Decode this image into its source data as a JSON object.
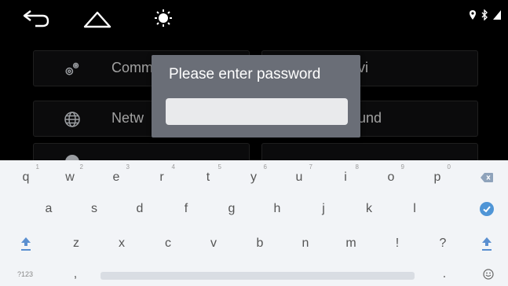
{
  "settings": {
    "tiles": [
      {
        "label": "Comm"
      },
      {
        "label": "vi"
      },
      {
        "label": "Netw"
      },
      {
        "label": "und"
      }
    ]
  },
  "dialog": {
    "title": "Please enter password",
    "input_value": ""
  },
  "keyboard": {
    "row1": [
      {
        "key": "q",
        "hint": "1"
      },
      {
        "key": "w",
        "hint": "2"
      },
      {
        "key": "e",
        "hint": "3"
      },
      {
        "key": "r",
        "hint": "4"
      },
      {
        "key": "t",
        "hint": "5"
      },
      {
        "key": "y",
        "hint": "6"
      },
      {
        "key": "u",
        "hint": "7"
      },
      {
        "key": "i",
        "hint": "8"
      },
      {
        "key": "o",
        "hint": "9"
      },
      {
        "key": "p",
        "hint": "0"
      }
    ],
    "row2": [
      "a",
      "s",
      "d",
      "f",
      "g",
      "h",
      "j",
      "k",
      "l"
    ],
    "row3": [
      "z",
      "x",
      "c",
      "v",
      "b",
      "n",
      "m",
      "!",
      "?"
    ],
    "sym_label": "?123",
    "comma": ",",
    "period": "."
  },
  "colors": {
    "accent": "#4f95d6",
    "dialog_bg": "#6a6e77",
    "keyboard_bg": "#f2f4f7"
  }
}
